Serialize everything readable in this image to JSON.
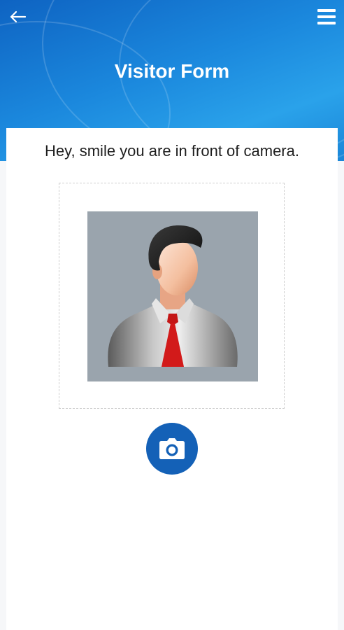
{
  "header": {
    "title": "Visitor Form",
    "back_icon": "arrow-left-icon",
    "menu_icon": "hamburger-menu-icon"
  },
  "main": {
    "instruction": "Hey, smile you are in front of camera.",
    "photo_placeholder": "default-avatar-man-with-red-tie",
    "capture_icon": "camera-icon"
  },
  "colors": {
    "header_blue": "#1b88dd",
    "camera_button": "#1461b7",
    "tie_red": "#d21a1a"
  }
}
